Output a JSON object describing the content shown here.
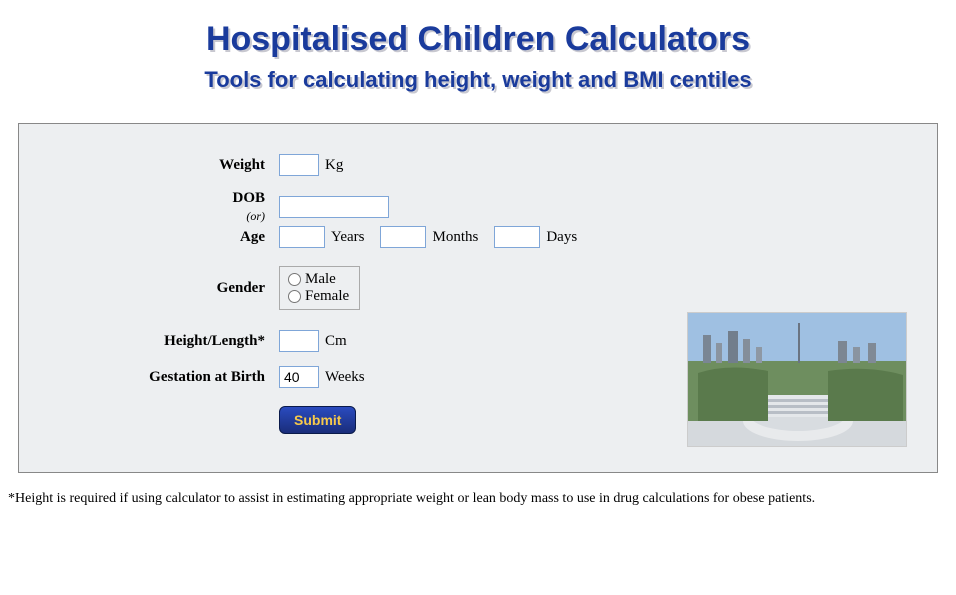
{
  "header": {
    "title": "Hospitalised Children Calculators",
    "subtitle": "Tools for calculating height, weight and BMI centiles"
  },
  "form": {
    "weight": {
      "label": "Weight",
      "value": "",
      "unit": "Kg"
    },
    "dob": {
      "label": "DOB",
      "or": "(or)",
      "value": ""
    },
    "age": {
      "label": "Age",
      "years_value": "",
      "years_unit": "Years",
      "months_value": "",
      "months_unit": "Months",
      "days_value": "",
      "days_unit": "Days"
    },
    "gender": {
      "label": "Gender",
      "male": "Male",
      "female": "Female"
    },
    "height": {
      "label": "Height/Length*",
      "value": "",
      "unit": "Cm"
    },
    "gestation": {
      "label": "Gestation at Birth",
      "value": "40",
      "unit": "Weeks"
    },
    "submit": "Submit"
  },
  "footnote": "*Height is required if using calculator to assist in estimating appropriate weight or lean body mass to use in drug calculations for obese patients."
}
